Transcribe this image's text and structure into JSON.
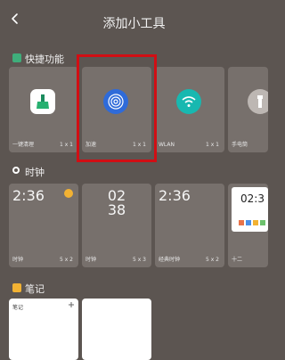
{
  "header": {
    "title": "添加小工具"
  },
  "sections": {
    "quick": {
      "title": "快捷功能",
      "color": "#3fae7b"
    },
    "clock": {
      "title": "时钟",
      "color": "#ffffff"
    },
    "notes": {
      "title": "笔记",
      "color": "#f2b233"
    }
  },
  "quick_cards": [
    {
      "name": "一键清理",
      "size": "1 x 1",
      "icon": "broom-clean-icon"
    },
    {
      "name": "加速",
      "size": "1 x 1",
      "icon": "fingerprint-icon"
    },
    {
      "name": "WLAN",
      "size": "1 x 1",
      "icon": "wifi-icon"
    },
    {
      "name": "手电筒",
      "size": "",
      "icon": "flashlight-icon"
    }
  ],
  "clock_cards": [
    {
      "name": "时钟",
      "size": "5 x 2",
      "time": "2:36"
    },
    {
      "name": "时钟",
      "size": "5 x 3",
      "time_hour": "02",
      "time_min": "38"
    },
    {
      "name": "经典时钟",
      "size": "5 x 2",
      "time": "2:36"
    },
    {
      "name": "十二",
      "size": "",
      "time": "02:3"
    }
  ],
  "note_cards": [
    {
      "title": "笔记"
    }
  ]
}
